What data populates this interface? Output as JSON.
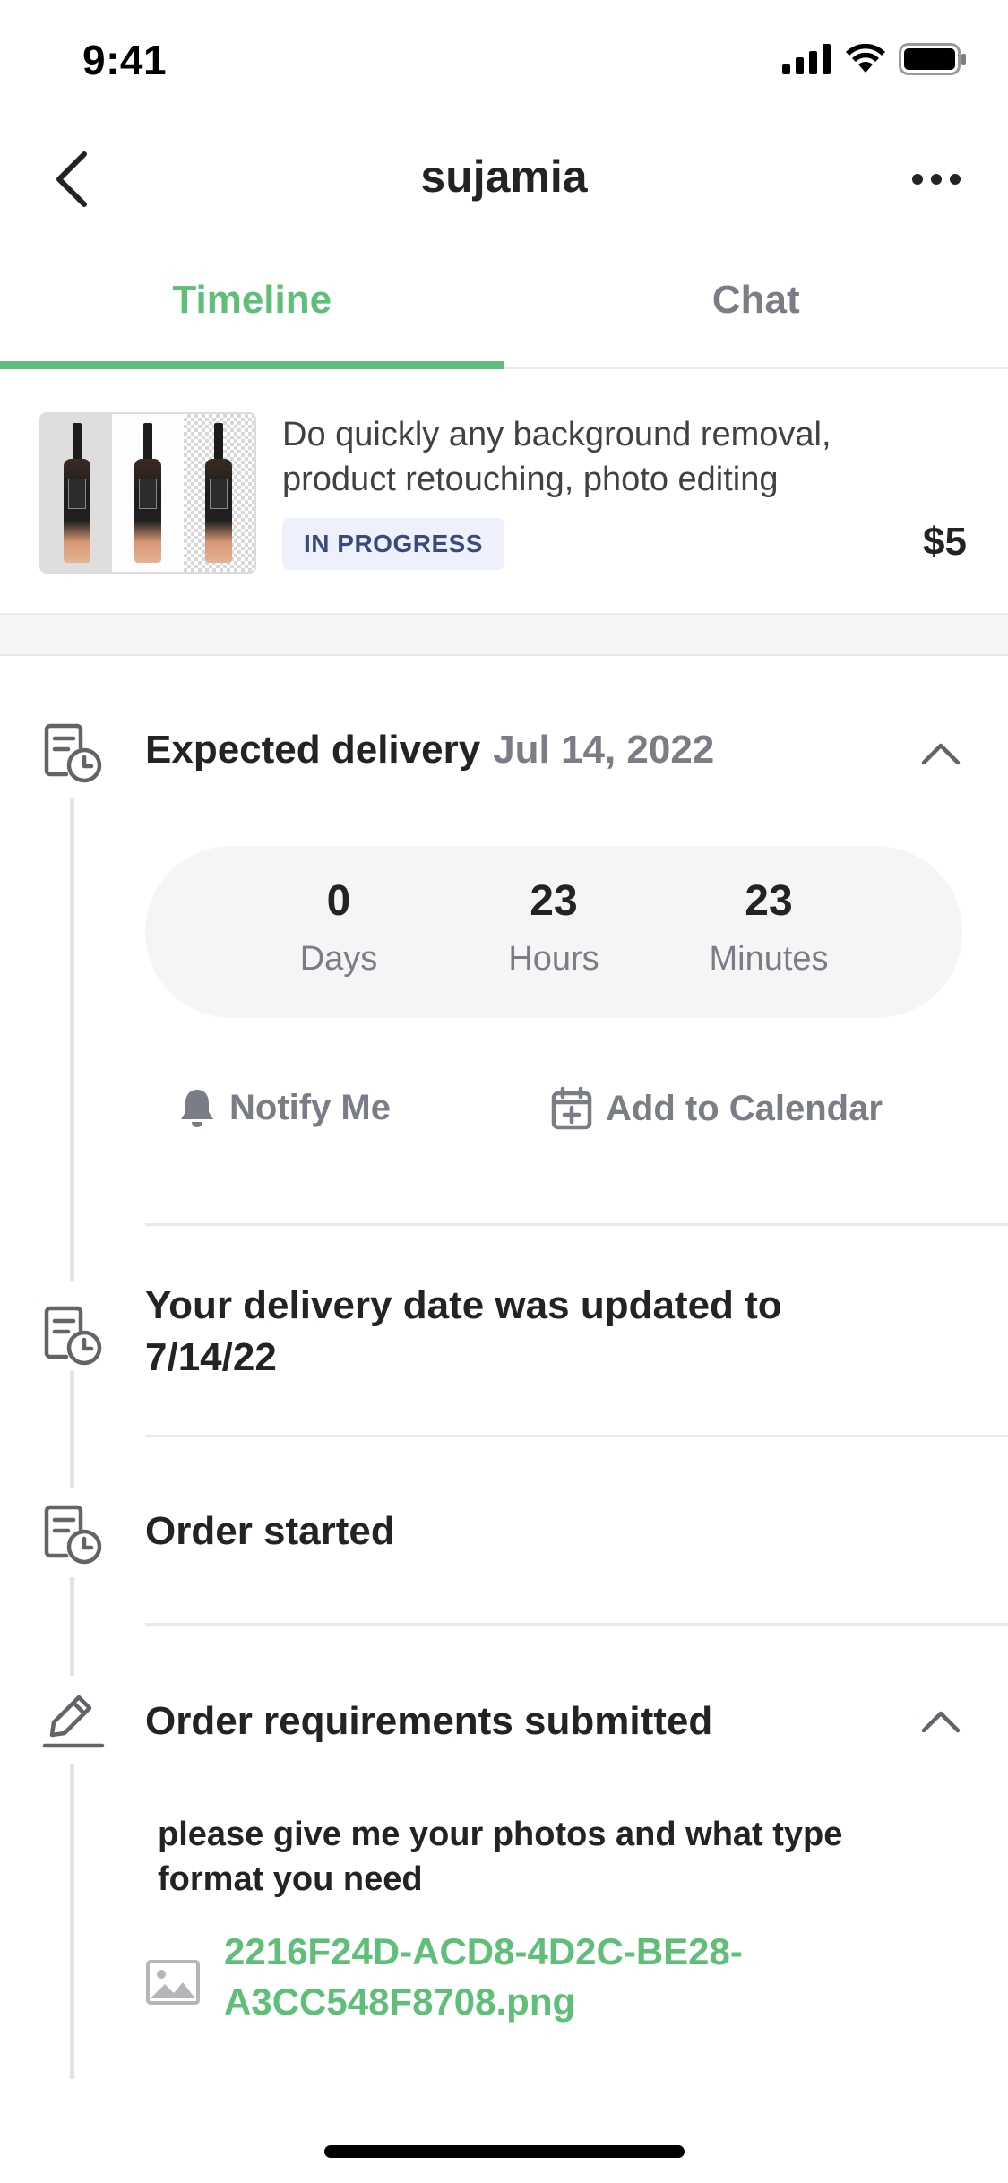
{
  "status_bar": {
    "time": "9:41"
  },
  "nav": {
    "title": "sujamia"
  },
  "tabs": [
    {
      "label": "Timeline",
      "active": true
    },
    {
      "label": "Chat",
      "active": false
    }
  ],
  "order": {
    "title": "Do quickly any background removal, product retouching, photo editing",
    "status": "IN PROGRESS",
    "price": "$5"
  },
  "delivery": {
    "label": "Expected delivery",
    "date": "Jul 14, 2022",
    "countdown": [
      {
        "value": "0",
        "unit": "Days"
      },
      {
        "value": "23",
        "unit": "Hours"
      },
      {
        "value": "23",
        "unit": "Minutes"
      }
    ],
    "notify_label": "Notify Me",
    "calendar_label": "Add to Calendar"
  },
  "events": {
    "date_updated": "Your delivery date was updated to 7/14/22",
    "order_started": "Order started",
    "requirements": "Order requirements submitted"
  },
  "requirements": {
    "text": "please give me your photos and what type format you need",
    "file": "2216F24D-ACD8-4D2C-BE28-A3CC548F8708.png"
  },
  "colors": {
    "accent": "#5fbf78",
    "badge_bg": "#eef1fb",
    "badge_text": "#3b4a7a",
    "muted": "#7a7d85"
  },
  "icons": {
    "back": "chevron-left-icon",
    "more": "more-dots-icon",
    "timeline": "calendar-clock-icon",
    "requirements": "pencil-icon",
    "notify": "bell-icon",
    "calendar": "calendar-add-icon",
    "file": "image-file-icon",
    "collapse": "chevron-up-icon"
  }
}
